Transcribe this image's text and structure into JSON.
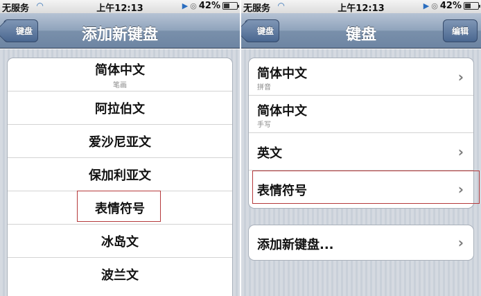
{
  "left": {
    "status": {
      "carrier": "无服务",
      "time": "上午12:13",
      "battery": "42%",
      "battery_level": 0.42
    },
    "nav": {
      "back_label": "键盘",
      "title": "添加新键盘"
    },
    "languages": [
      {
        "label": "简体中文",
        "sub": "笔画"
      },
      {
        "label": "阿拉伯文"
      },
      {
        "label": "爱沙尼亚文"
      },
      {
        "label": "保加利亚文"
      },
      {
        "label": "表情符号",
        "highlighted": true
      },
      {
        "label": "冰岛文"
      },
      {
        "label": "波兰文"
      }
    ]
  },
  "right": {
    "status": {
      "carrier": "无服务",
      "time": "上午12:13",
      "battery": "42%",
      "battery_level": 0.42
    },
    "nav": {
      "back_label": "键盘",
      "title": "键盘",
      "edit_label": "编辑"
    },
    "keyboards": [
      {
        "label": "简体中文",
        "sub": "拼音",
        "chevron": true
      },
      {
        "label": "简体中文",
        "sub": "手写",
        "chevron": false
      },
      {
        "label": "英文",
        "chevron": true
      },
      {
        "label": "表情符号",
        "chevron": true,
        "highlighted": true
      }
    ],
    "add_keyboard_label": "添加新键盘..."
  },
  "colors": {
    "highlight_border": "#b5393b",
    "nav_gradient_dark": "#6d85a3",
    "background_stripe": "#c9d0d9"
  }
}
